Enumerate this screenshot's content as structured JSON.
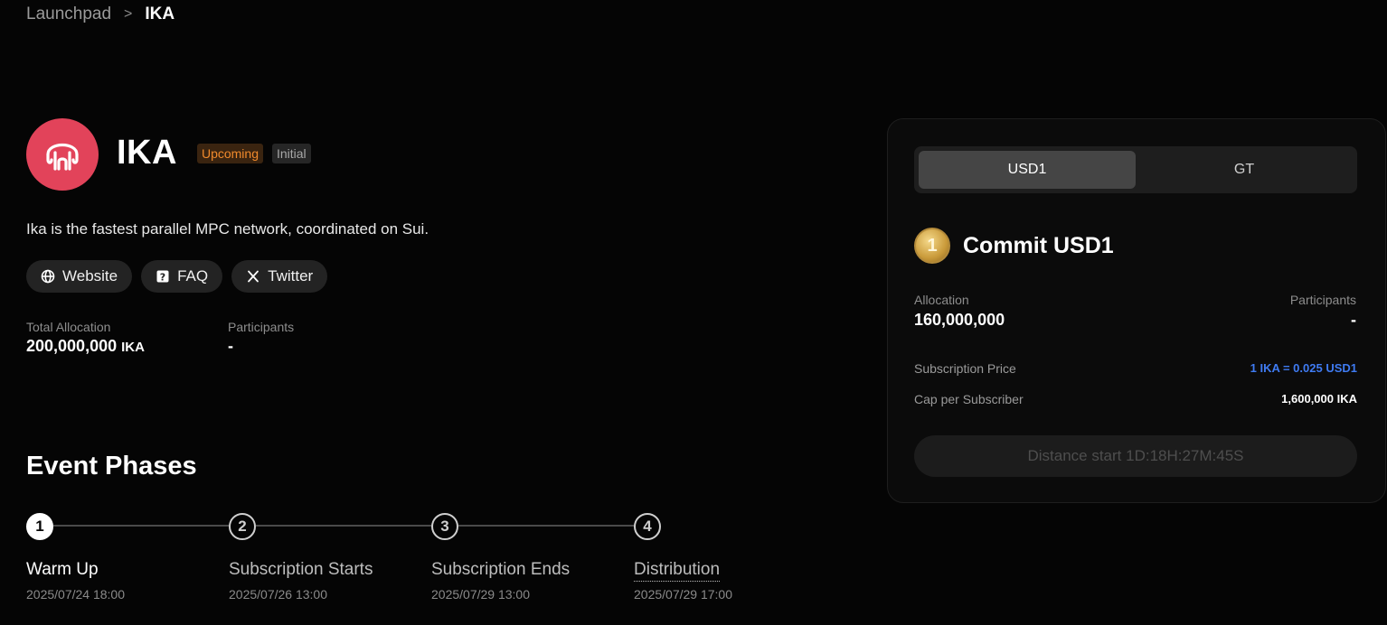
{
  "breadcrumb": {
    "parent": "Launchpad",
    "separator": ">",
    "current": "IKA"
  },
  "project": {
    "name": "IKA",
    "status_badge": "Upcoming",
    "type_badge": "Initial",
    "description": "Ika is the fastest parallel MPC network, coordinated on Sui.",
    "logo_icon": "octopus-logo-icon",
    "brand_color": "#e2435a"
  },
  "links": [
    {
      "label": "Website",
      "icon": "globe-icon"
    },
    {
      "label": "FAQ",
      "icon": "question-icon"
    },
    {
      "label": "Twitter",
      "icon": "x-icon"
    }
  ],
  "stats": {
    "total_allocation_label": "Total Allocation",
    "total_allocation_value": "200,000,000",
    "total_allocation_unit": "IKA",
    "participants_label": "Participants",
    "participants_value": "-"
  },
  "phases": {
    "title": "Event Phases",
    "items": [
      {
        "number": "1",
        "name": "Warm Up",
        "date": "2025/07/24 18:00"
      },
      {
        "number": "2",
        "name": "Subscription Starts",
        "date": "2025/07/26 13:00"
      },
      {
        "number": "3",
        "name": "Subscription Ends",
        "date": "2025/07/29 13:00"
      },
      {
        "number": "4",
        "name": "Distribution",
        "date": "2025/07/29 17:00"
      }
    ]
  },
  "commit_card": {
    "tabs": [
      "USD1",
      "GT"
    ],
    "selected_tab": "USD1",
    "coin_symbol": "1",
    "title": "Commit USD1",
    "allocation_label": "Allocation",
    "allocation_value": "160,000,000",
    "participants_label": "Participants",
    "participants_value": "-",
    "price_label": "Subscription Price",
    "price_value": "1 IKA = 0.025 USD1",
    "cap_label": "Cap per Subscriber",
    "cap_value": "1,600,000 IKA",
    "action_label": "Distance start 1D:18H:27M:45S",
    "accent_color": "#3f7bf2"
  }
}
